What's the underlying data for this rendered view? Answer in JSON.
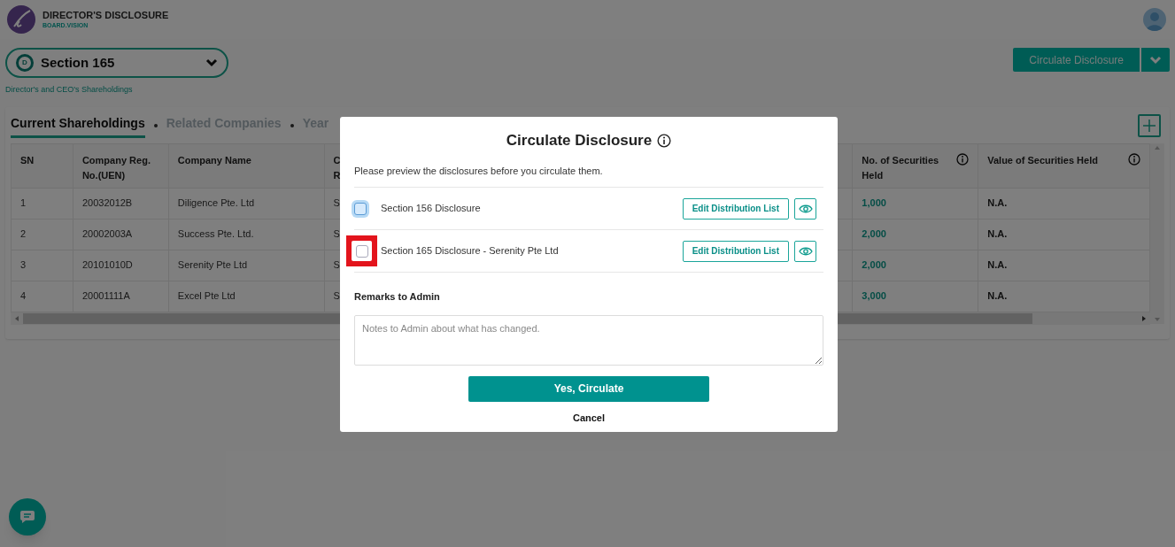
{
  "app": {
    "title": "DIRECTOR'S DISCLOSURE",
    "subtitle": "BOARD.VISION"
  },
  "section_select": {
    "badge": "D",
    "label": "Section 165"
  },
  "breadcrumb": "Director's and CEO's Shareholdings",
  "circulate_button": {
    "label": "Circulate Disclosure"
  },
  "tabs": [
    {
      "label": "Current Shareholdings",
      "selected": true
    },
    {
      "label": "Related Companies",
      "selected": false
    },
    {
      "label": "Year",
      "selected": false
    }
  ],
  "table": {
    "columns": [
      {
        "lines": [
          "SN"
        ],
        "kind": "text",
        "info": false
      },
      {
        "lines": [
          "Company Reg.",
          "No.(UEN)"
        ],
        "kind": "text",
        "info": false
      },
      {
        "lines": [
          "Company Name"
        ],
        "kind": "text",
        "info": false
      },
      {
        "lines": [
          "C",
          "R"
        ],
        "kind": "text",
        "info": false
      },
      {
        "lines": [
          "No. of Securities",
          "Held"
        ],
        "kind": "count",
        "info": true
      },
      {
        "lines": [
          "Value of Securities Held"
        ],
        "kind": "strong",
        "info": true
      }
    ],
    "rows": [
      {
        "cells": [
          "1",
          "20032012B",
          "Diligence Pte. Ltd",
          "S",
          "1,000",
          "N.A."
        ]
      },
      {
        "cells": [
          "2",
          "20002003A",
          "Success Pte. Ltd.",
          "S",
          "2,000",
          "N.A."
        ]
      },
      {
        "cells": [
          "3",
          "20101010D",
          "Serenity Pte Ltd",
          "S",
          "2,000",
          "N.A."
        ]
      },
      {
        "cells": [
          "4",
          "20001111A",
          "Excel Pte Ltd",
          "S",
          "3,000",
          "N.A."
        ]
      }
    ]
  },
  "modal": {
    "title": "Circulate Disclosure",
    "intro": "Please preview the disclosures before you circulate them.",
    "items": [
      {
        "label": "Section 156 Disclosure",
        "checked": false,
        "focused": true,
        "highlighted": false,
        "edit_label": "Edit Distribution List"
      },
      {
        "label": "Section 165 Disclosure - Serenity Pte Ltd",
        "checked": false,
        "focused": false,
        "highlighted": true,
        "edit_label": "Edit Distribution List"
      }
    ],
    "remarks_label": "Remarks to Admin",
    "remarks_placeholder": "Notes to Admin about what has changed.",
    "confirm": "Yes, Circulate",
    "cancel": "Cancel"
  }
}
